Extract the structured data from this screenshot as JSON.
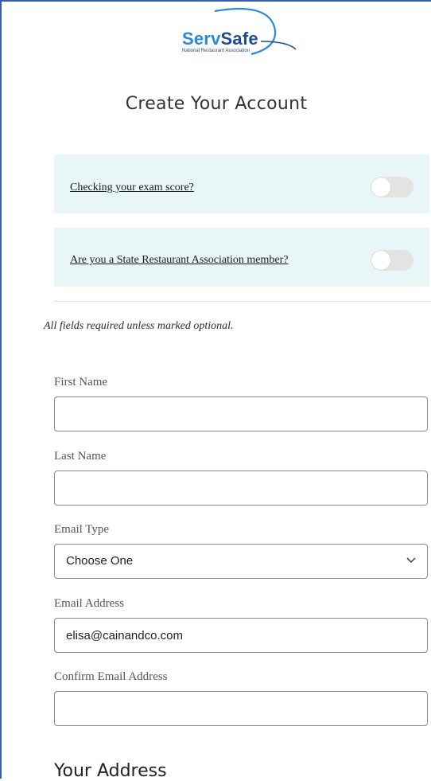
{
  "brand": {
    "name_part1": "Serv",
    "name_part2": "Safe",
    "tagline": "National Restaurant Association",
    "accent_light": "#2a8ad6",
    "accent_dark": "#1f4b93"
  },
  "page_title": "Create Your Account",
  "toggles": [
    {
      "label": "Checking your exam score?",
      "on": false
    },
    {
      "label": "Are you a State Restaurant Association member?",
      "on": false
    }
  ],
  "required_note": "All fields required unless marked optional.",
  "form": {
    "first_name": {
      "label": "First Name",
      "value": ""
    },
    "last_name": {
      "label": "Last Name",
      "value": ""
    },
    "email_type": {
      "label": "Email Type",
      "selected": "Choose One"
    },
    "email_address": {
      "label": "Email Address",
      "value": "elisa@cainandco.com"
    },
    "confirm_email": {
      "label": "Confirm Email Address",
      "value": ""
    }
  },
  "address_heading": "Your Address",
  "colors": {
    "toggle_bg": "#e9f6f8",
    "switch_off": "#e3e3e3",
    "frame": "#3a5fa8"
  }
}
